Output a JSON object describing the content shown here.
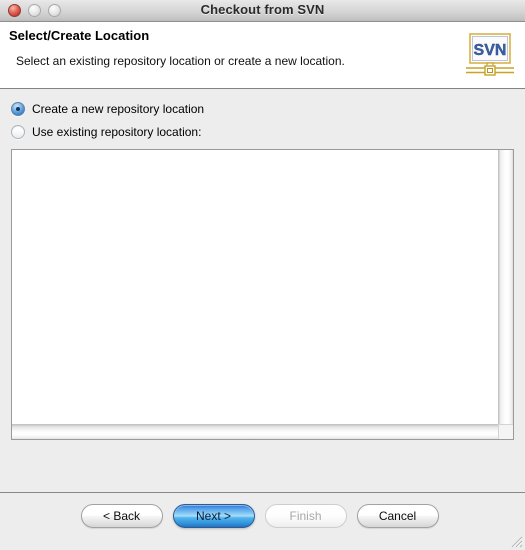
{
  "window": {
    "title": "Checkout from SVN",
    "traffic_lights": [
      {
        "name": "close",
        "label": "Close",
        "active": true
      },
      {
        "name": "minimize",
        "label": "Minimize",
        "active": false
      },
      {
        "name": "zoom",
        "label": "Zoom",
        "active": false
      }
    ]
  },
  "header": {
    "title": "Select/Create Location",
    "subtitle": "Select an existing repository location or create a new location.",
    "logo_text": "SVN",
    "logo_name": "svn-logo-icon"
  },
  "options": {
    "create_new": {
      "label": "Create a new repository location",
      "selected": true
    },
    "use_existing": {
      "label": "Use existing repository location:",
      "selected": false
    }
  },
  "list": {
    "items": [],
    "empty": true
  },
  "footer": {
    "buttons": [
      {
        "name": "back",
        "label": "< Back",
        "style": "normal",
        "enabled": true
      },
      {
        "name": "next",
        "label": "Next >",
        "style": "default",
        "enabled": true
      },
      {
        "name": "finish",
        "label": "Finish",
        "style": "disabled",
        "enabled": false
      },
      {
        "name": "cancel",
        "label": "Cancel",
        "style": "normal",
        "enabled": true
      }
    ]
  },
  "colors": {
    "titlebar_text": "#2b2b2b",
    "body_background": "#ededed",
    "header_background": "#ffffff",
    "default_button_blue": "#4f9be8",
    "radio_selected_blue": "#4f93d8",
    "close_button_red": "#c6392e",
    "svn_logo_blue": "#3b5fa8",
    "svn_logo_gold": "#c9a227"
  }
}
